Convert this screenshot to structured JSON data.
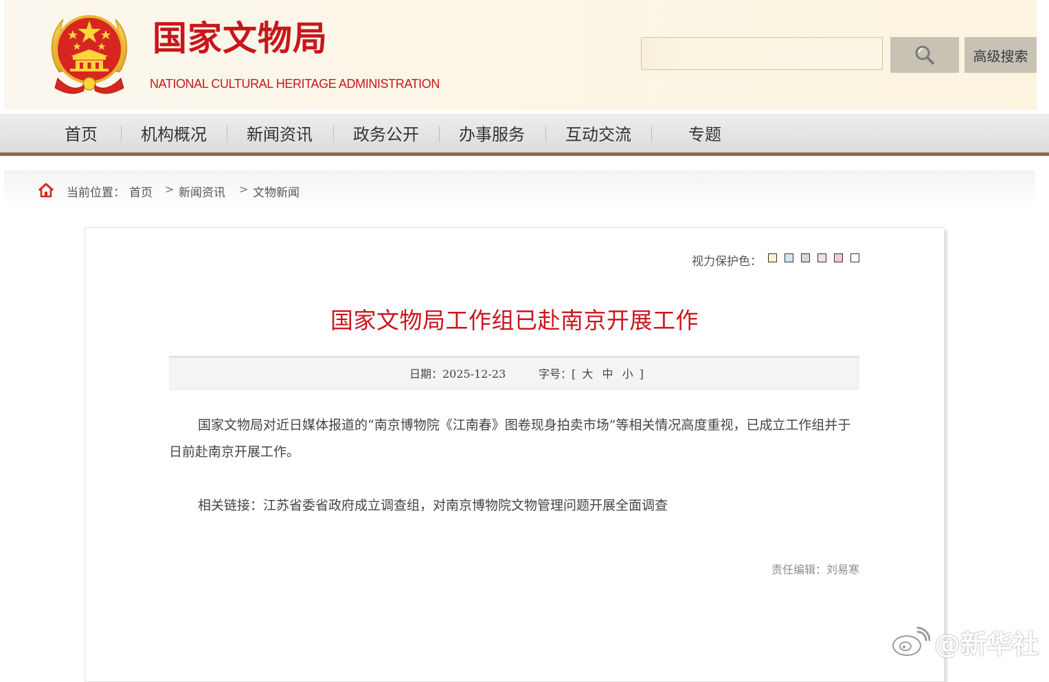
{
  "header": {
    "site_title": "国家文物局",
    "site_subtitle": "NATIONAL  CULTURAL HERITAGE ADMINISTRATION",
    "search_placeholder": "",
    "advanced_search_label": "高级搜索",
    "brand_red": "#c8161d"
  },
  "nav": {
    "items": [
      {
        "label": "首页"
      },
      {
        "label": "机构概况"
      },
      {
        "label": "新闻资讯"
      },
      {
        "label": "政务公开"
      },
      {
        "label": "办事服务"
      },
      {
        "label": "互动交流"
      },
      {
        "label": "专题"
      }
    ],
    "underline_color": "#8a6a45"
  },
  "breadcrumb": {
    "prefix": "当前位置：",
    "items": [
      "首页",
      "新闻资讯",
      "文物新闻"
    ],
    "separator": ">"
  },
  "article": {
    "eye_protection_label": "视力保护色：",
    "eye_colors": [
      "#fbf3c5",
      "#cfe7f5",
      "#d8d8d8",
      "#f5dede",
      "#f4c9d7",
      "#ffffff"
    ],
    "title": "国家文物局工作组已赴南京开展工作",
    "date": "日期：2025-12-23",
    "font_size_prefix": "字号：[",
    "font_size_large": "大",
    "font_size_medium": "中",
    "font_size_small": "小",
    "font_size_suffix": "]",
    "paragraph_1": "国家文物局对近日媒体报道的“南京博物院《江南春》图卷现身拍卖市场”等相关情况高度重视，已成立工作组并于日前赴南京开展工作。",
    "related_label": "相关链接：",
    "related_link_text": "江苏省委省政府成立调查组，对南京博物院文物管理问题开展全面调查",
    "editor": "责任编辑：刘易寒"
  },
  "watermark": {
    "text": "@新华社"
  }
}
